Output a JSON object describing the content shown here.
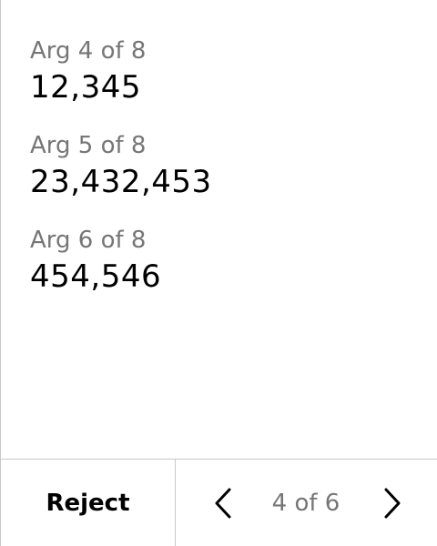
{
  "args": [
    {
      "label": "Arg 4 of 8",
      "value": "12,345"
    },
    {
      "label": "Arg 5 of 8",
      "value": "23,432,453"
    },
    {
      "label": "Arg 6 of 8",
      "value": "454,546"
    }
  ],
  "footer": {
    "reject_label": "Reject",
    "page_indicator": "4 of 6",
    "prev_icon": "chevron-left-icon",
    "next_icon": "chevron-right-icon"
  },
  "colors": {
    "label_gray": "#767676",
    "value_black": "#000000",
    "divider": "#c8c8c8"
  }
}
